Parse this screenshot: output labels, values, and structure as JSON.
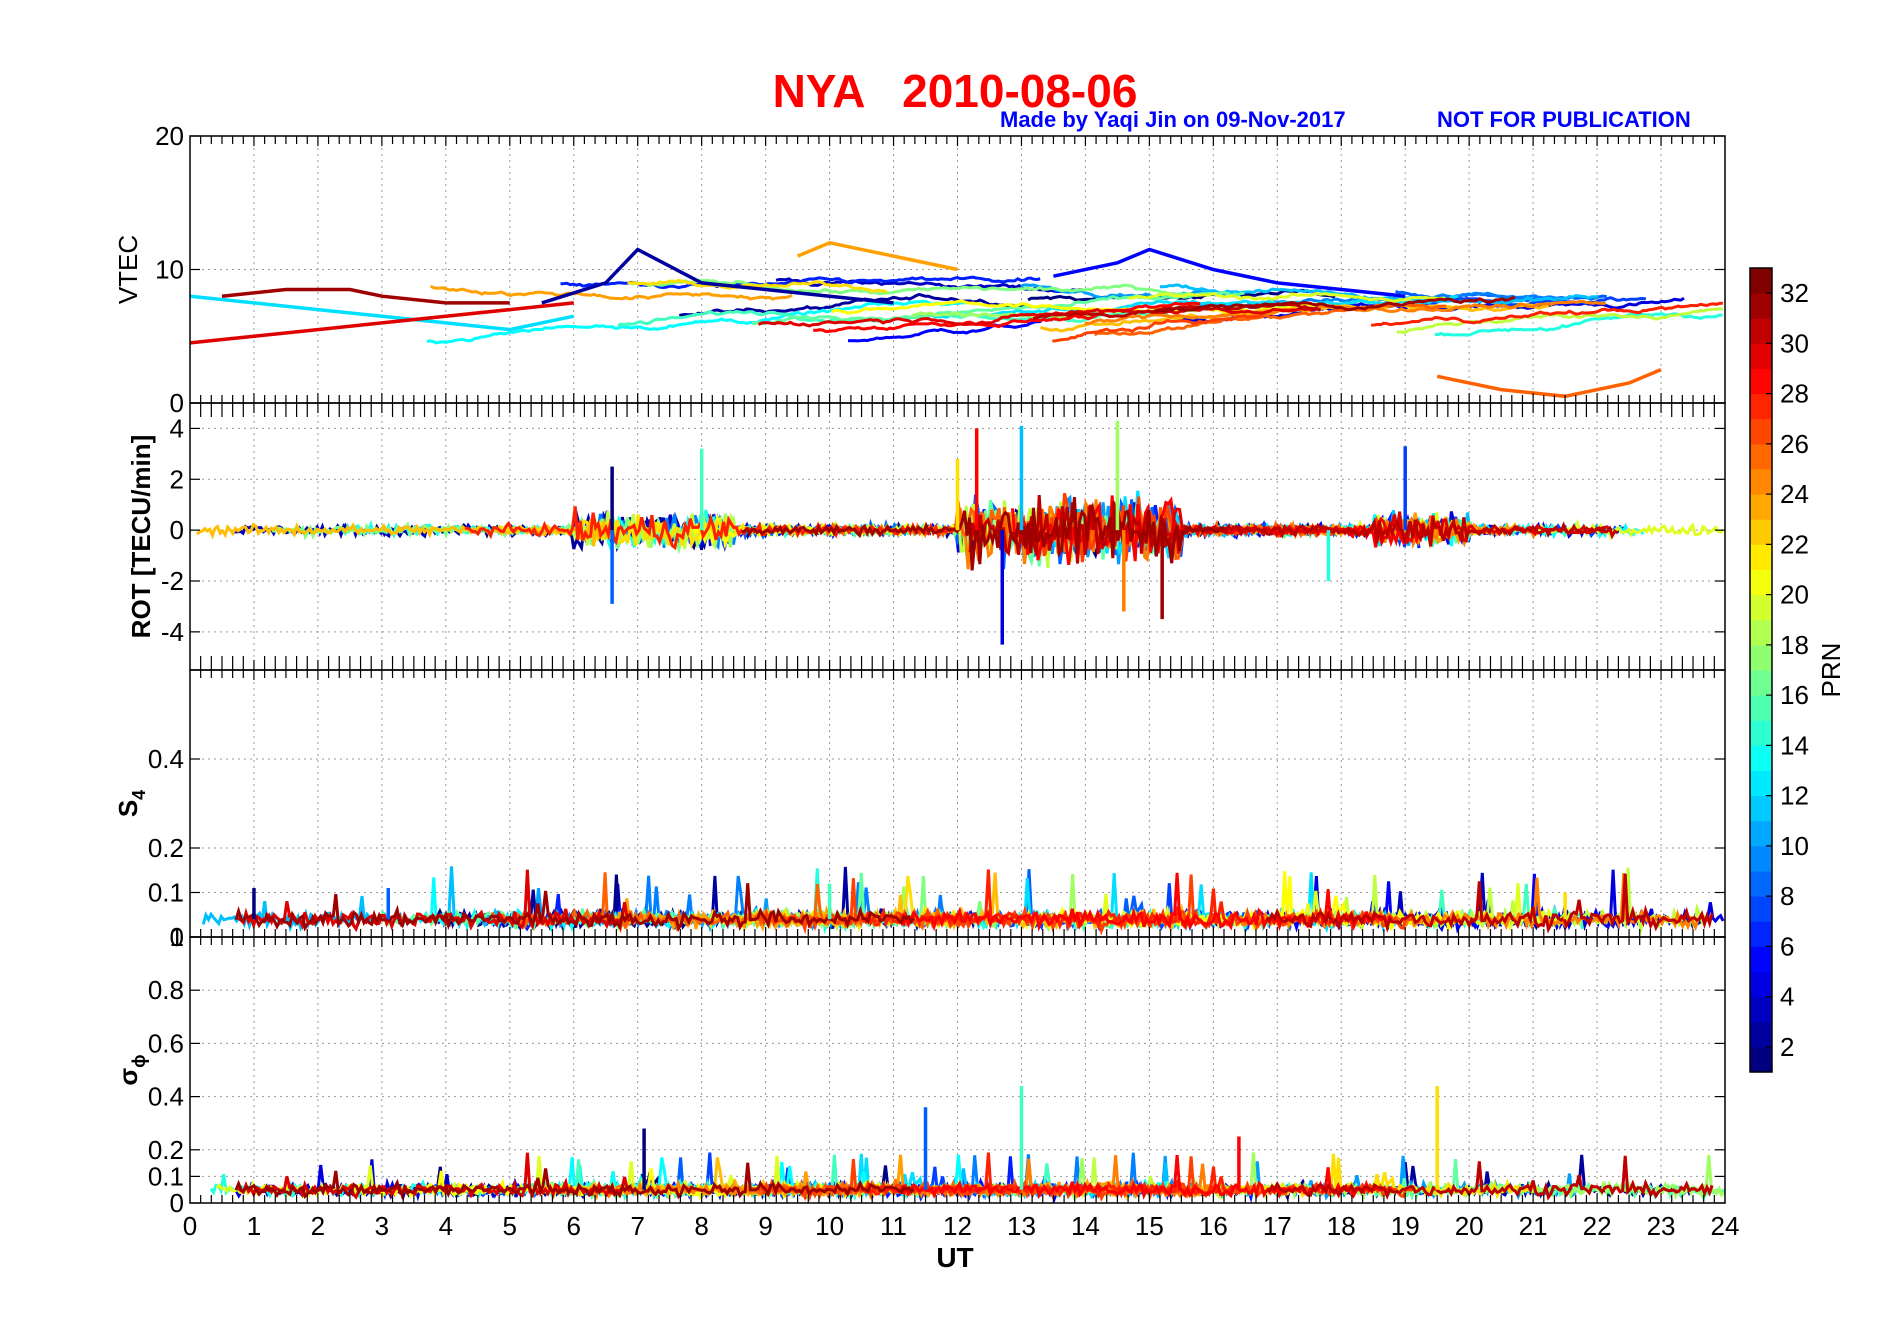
{
  "figure": {
    "title": "NYA   2010-08-06",
    "credit": "Made by Yaqi Jin on 09-Nov-2017",
    "notice": "NOT FOR PUBLICATION",
    "xlabel": "UT",
    "title_color": "#ff0000",
    "credit_color": "#0000ff"
  },
  "colorbar": {
    "label": "PRN",
    "range": [
      1,
      33
    ],
    "ticks": [
      "2",
      "4",
      "6",
      "8",
      "10",
      "12",
      "14",
      "16",
      "18",
      "20",
      "22",
      "24",
      "26",
      "28",
      "30",
      "32"
    ],
    "colormap": "jet"
  },
  "chart_data": [
    {
      "type": "line",
      "panel": "VTEC",
      "ylabel": "VTEC",
      "xlim": [
        0,
        24
      ],
      "ylim": [
        0,
        20
      ],
      "yticks": [
        "0",
        "10",
        "20"
      ],
      "grid": true,
      "series_summary": [
        {
          "prn": 2,
          "x": [
            5.5,
            6.5,
            7.0,
            8.0,
            9.0,
            10.0,
            11.0
          ],
          "y": [
            7.5,
            9.0,
            11.5,
            9.0,
            8.5,
            8.0,
            7.5
          ]
        },
        {
          "prn": 5,
          "x": [
            13.5,
            14.5,
            15.0,
            16.0,
            17.0,
            18.0,
            19.0
          ],
          "y": [
            9.5,
            10.5,
            11.5,
            10.0,
            9.0,
            8.5,
            8.0
          ]
        },
        {
          "prn": 12,
          "x": [
            0.0,
            1.0,
            2.0,
            3.0,
            4.0,
            5.0,
            6.0
          ],
          "y": [
            8.0,
            7.5,
            7.0,
            6.5,
            6.0,
            5.5,
            6.5
          ]
        },
        {
          "prn": 24,
          "x": [
            9.5,
            10.0,
            11.0,
            12.0
          ],
          "y": [
            11.0,
            12.0,
            11.0,
            10.0
          ]
        },
        {
          "prn": 26,
          "x": [
            19.5,
            20.5,
            21.5,
            22.5,
            23.0
          ],
          "y": [
            2.0,
            1.0,
            0.5,
            1.5,
            2.5
          ]
        },
        {
          "prn": 30,
          "x": [
            0.0,
            1.0,
            2.0,
            3.0,
            4.0,
            5.0,
            6.0
          ],
          "y": [
            4.5,
            5.0,
            5.5,
            6.0,
            6.5,
            7.0,
            7.5
          ]
        },
        {
          "prn": 32,
          "x": [
            0.5,
            1.5,
            2.5,
            3.0,
            4.0,
            5.0
          ],
          "y": [
            8.0,
            8.5,
            8.5,
            8.0,
            7.5,
            7.5
          ]
        }
      ]
    },
    {
      "type": "line",
      "panel": "ROT",
      "ylabel": "ROT [TECU/min]",
      "xlim": [
        0,
        24
      ],
      "ylim": [
        -5.5,
        5.0
      ],
      "yticks": [
        "-4",
        "-2",
        "0",
        "2",
        "4"
      ],
      "grid": true,
      "peaks": [
        {
          "x": 6.6,
          "y": 2.5
        },
        {
          "x": 6.6,
          "y": -2.9
        },
        {
          "x": 8.0,
          "y": 3.2
        },
        {
          "x": 12.0,
          "y": 2.8
        },
        {
          "x": 12.3,
          "y": 4.0
        },
        {
          "x": 12.7,
          "y": -4.5
        },
        {
          "x": 13.0,
          "y": 4.1
        },
        {
          "x": 14.5,
          "y": 4.3
        },
        {
          "x": 14.6,
          "y": -3.2
        },
        {
          "x": 15.2,
          "y": -3.5
        },
        {
          "x": 19.0,
          "y": 3.3
        },
        {
          "x": 17.8,
          "y": -2.0
        }
      ]
    },
    {
      "type": "line",
      "panel": "S4",
      "ylabel": "S",
      "ylabel_sub": "4",
      "xlim": [
        0,
        24
      ],
      "ylim": [
        0,
        0.6
      ],
      "yticks": [
        "0",
        "0.1",
        "0.2",
        "0.4"
      ],
      "grid": true,
      "typical": 0.04,
      "peaks": [
        {
          "x": 1.0,
          "y": 0.11
        },
        {
          "x": 3.1,
          "y": 0.11
        },
        {
          "x": 10.0,
          "y": 0.12
        },
        {
          "x": 21.5,
          "y": 0.1
        }
      ]
    },
    {
      "type": "line",
      "panel": "SigmaPhi",
      "ylabel": "σ",
      "ylabel_sub": "ϕ",
      "xlim": [
        0,
        24
      ],
      "ylim": [
        0,
        1.0
      ],
      "yticks": [
        "0",
        "0.1",
        "0.2",
        "0.4",
        "0.6",
        "0.8",
        "1"
      ],
      "xticks": [
        "0",
        "1",
        "2",
        "3",
        "4",
        "5",
        "6",
        "7",
        "8",
        "9",
        "10",
        "11",
        "12",
        "13",
        "14",
        "15",
        "16",
        "17",
        "18",
        "19",
        "20",
        "21",
        "22",
        "23",
        "24"
      ],
      "grid": true,
      "typical": 0.05,
      "peaks": [
        {
          "x": 7.1,
          "y": 0.28
        },
        {
          "x": 11.5,
          "y": 0.36
        },
        {
          "x": 13.0,
          "y": 0.44
        },
        {
          "x": 19.5,
          "y": 0.44
        },
        {
          "x": 16.4,
          "y": 0.25
        }
      ]
    }
  ]
}
